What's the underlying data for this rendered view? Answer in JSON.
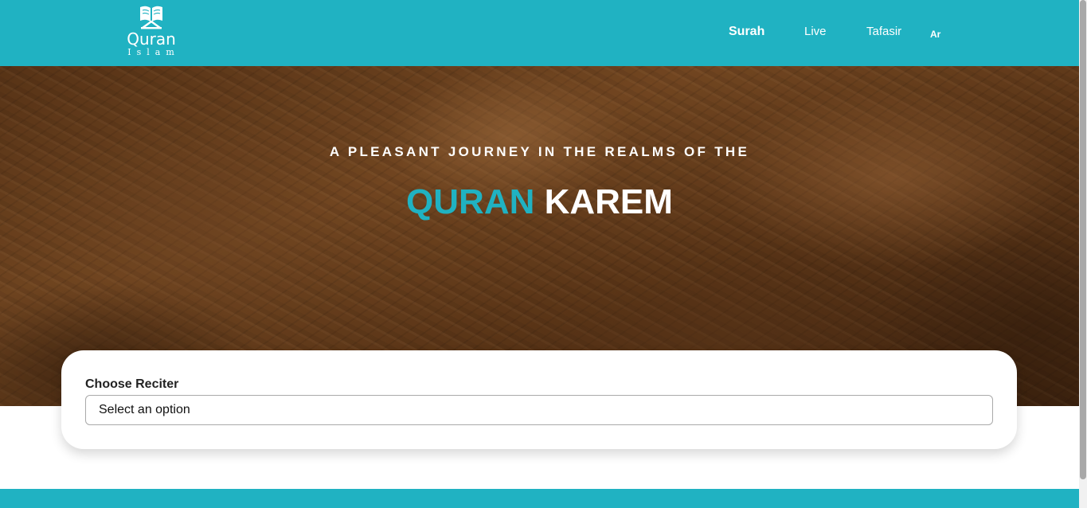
{
  "header": {
    "logo": {
      "icon": "open-quran-book-icon",
      "title": "Quran",
      "subtitle": "Islam"
    },
    "nav": [
      {
        "label": "Surah"
      },
      {
        "label": "Live"
      },
      {
        "label": "Tafasir"
      },
      {
        "label": "Ar"
      }
    ]
  },
  "hero": {
    "subtitle": "A PLEASANT JOURNEY IN THE REALMS OF THE",
    "title_accent": "QURAN",
    "title_rest": "KAREM"
  },
  "reciter_card": {
    "label": "Choose Reciter",
    "select_value": "Select an option"
  },
  "colors": {
    "brand": "#20b2c2",
    "hero_tone": "#7a4a22",
    "text_dark": "#222222"
  }
}
